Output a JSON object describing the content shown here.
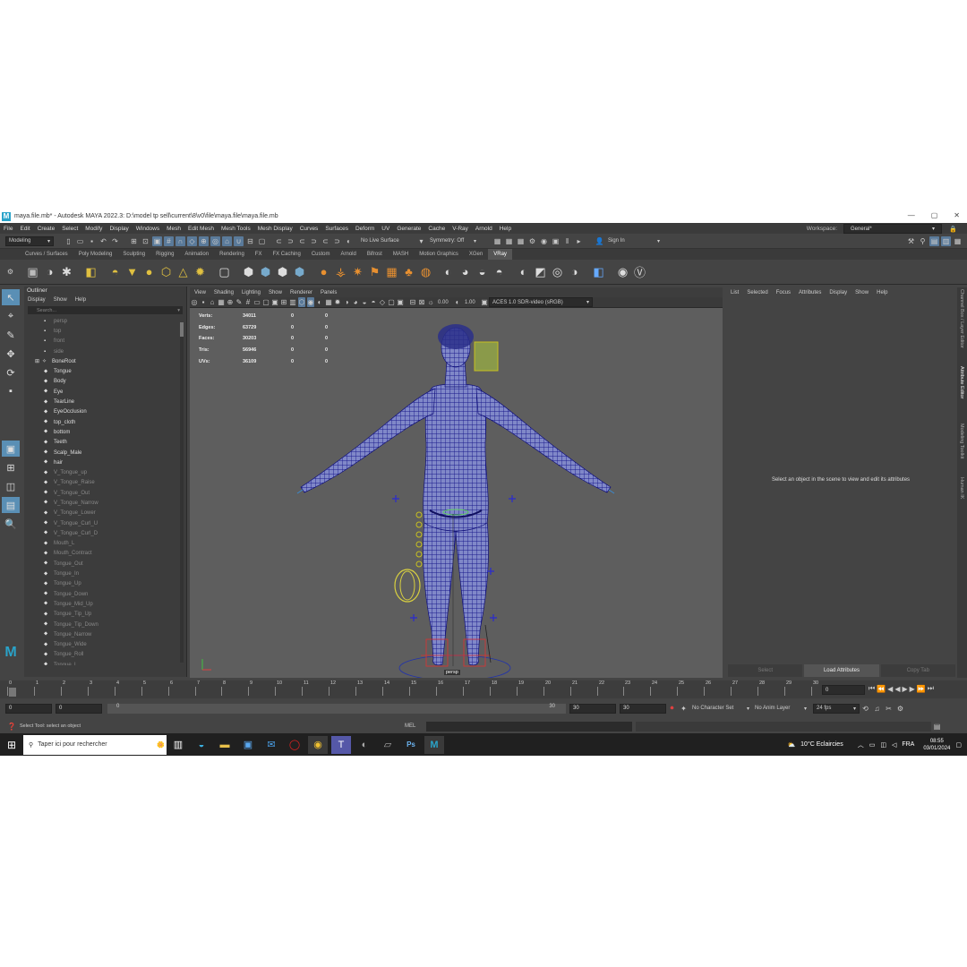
{
  "window": {
    "title": "maya.file.mb* - Autodesk MAYA 2022.3: D:\\model tp sell\\current\\8\\v0\\file\\maya.file\\maya.file.mb",
    "logo": "M",
    "controls": [
      "—",
      "▢",
      "✕"
    ]
  },
  "menu": [
    "File",
    "Edit",
    "Create",
    "Select",
    "Modify",
    "Display",
    "Windows",
    "Mesh",
    "Edit Mesh",
    "Mesh Tools",
    "Mesh Display",
    "Curves",
    "Surfaces",
    "Deform",
    "UV",
    "Generate",
    "Cache",
    "V-Ray",
    "Arnold",
    "Help"
  ],
  "workspace": {
    "label": "Workspace:",
    "value": "General*"
  },
  "status": {
    "mode": "Modeling",
    "live_surface": "No Live Surface",
    "symmetry": "Symmetry: Off",
    "sign_in": "Sign In"
  },
  "shelf_tabs": [
    "Curves / Surfaces",
    "Poly Modeling",
    "Sculpting",
    "Rigging",
    "Animation",
    "Rendering",
    "FX",
    "FX Caching",
    "Custom",
    "Arnold",
    "Bifrost",
    "MASH",
    "Motion Graphics",
    "XGen",
    "VRay"
  ],
  "shelf_active": "VRay",
  "outliner": {
    "title": "Outliner",
    "menu": [
      "Display",
      "Show",
      "Help"
    ],
    "search_placeholder": "Search...",
    "items": [
      {
        "name": "persp",
        "icon": "camera",
        "dim": true
      },
      {
        "name": "top",
        "icon": "camera",
        "dim": true
      },
      {
        "name": "front",
        "icon": "camera",
        "dim": true
      },
      {
        "name": "side",
        "icon": "camera",
        "dim": true
      },
      {
        "name": "BoneRoot",
        "icon": "joint",
        "dim": false,
        "expandable": true
      },
      {
        "name": "Tongue",
        "icon": "mesh",
        "dim": false
      },
      {
        "name": "Body",
        "icon": "mesh",
        "dim": false
      },
      {
        "name": "Eye",
        "icon": "mesh",
        "dim": false
      },
      {
        "name": "TearLine",
        "icon": "mesh",
        "dim": false
      },
      {
        "name": "EyeOcclusion",
        "icon": "mesh",
        "dim": false
      },
      {
        "name": "top_cloth",
        "icon": "mesh",
        "dim": false
      },
      {
        "name": "bottom",
        "icon": "mesh",
        "dim": false
      },
      {
        "name": "Teeth",
        "icon": "mesh",
        "dim": false
      },
      {
        "name": "Scalp_Male",
        "icon": "mesh",
        "dim": false
      },
      {
        "name": "hair",
        "icon": "mesh",
        "dim": false
      },
      {
        "name": "V_Tongue_up",
        "icon": "mesh",
        "dim": true
      },
      {
        "name": "V_Tongue_Raise",
        "icon": "mesh",
        "dim": true
      },
      {
        "name": "V_Tongue_Out",
        "icon": "mesh",
        "dim": true
      },
      {
        "name": "V_Tongue_Narrow",
        "icon": "mesh",
        "dim": true
      },
      {
        "name": "V_Tongue_Lower",
        "icon": "mesh",
        "dim": true
      },
      {
        "name": "V_Tongue_Curl_U",
        "icon": "mesh",
        "dim": true
      },
      {
        "name": "V_Tongue_Curl_D",
        "icon": "mesh",
        "dim": true
      },
      {
        "name": "Mouth_L",
        "icon": "mesh",
        "dim": true
      },
      {
        "name": "Mouth_Contract",
        "icon": "mesh",
        "dim": true
      },
      {
        "name": "Tongue_Out",
        "icon": "mesh",
        "dim": true
      },
      {
        "name": "Tongue_In",
        "icon": "mesh",
        "dim": true
      },
      {
        "name": "Tongue_Up",
        "icon": "mesh",
        "dim": true
      },
      {
        "name": "Tongue_Down",
        "icon": "mesh",
        "dim": true
      },
      {
        "name": "Tongue_Mid_Up",
        "icon": "mesh",
        "dim": true
      },
      {
        "name": "Tongue_Tip_Up",
        "icon": "mesh",
        "dim": true
      },
      {
        "name": "Tongue_Tip_Down",
        "icon": "mesh",
        "dim": true
      },
      {
        "name": "Tongue_Narrow",
        "icon": "mesh",
        "dim": true
      },
      {
        "name": "Tongue_Wide",
        "icon": "mesh",
        "dim": true
      },
      {
        "name": "Tongue_Roll",
        "icon": "mesh",
        "dim": true
      },
      {
        "name": "Tongue_L",
        "icon": "mesh",
        "dim": true
      }
    ]
  },
  "viewport": {
    "menu": [
      "View",
      "Shading",
      "Lighting",
      "Show",
      "Renderer",
      "Panels"
    ],
    "exposure": "0.00",
    "gamma": "1.00",
    "color_space": "ACES 1.0 SDR-video (sRGB)",
    "camera_label": "persp",
    "stats": [
      {
        "label": "Verts:",
        "a": "34011",
        "b": "0",
        "c": "0"
      },
      {
        "label": "Edges:",
        "a": "63729",
        "b": "0",
        "c": "0"
      },
      {
        "label": "Faces:",
        "a": "30203",
        "b": "0",
        "c": "0"
      },
      {
        "label": "Tris:",
        "a": "56946",
        "b": "0",
        "c": "0"
      },
      {
        "label": "UVs:",
        "a": "36109",
        "b": "0",
        "c": "0"
      }
    ]
  },
  "attribute_editor": {
    "menu": [
      "List",
      "Selected",
      "Focus",
      "Attributes",
      "Display",
      "Show",
      "Help"
    ],
    "message": "Select an object in the scene to view and edit its attributes",
    "buttons": [
      "Select",
      "Load Attributes",
      "Copy Tab"
    ],
    "side_tabs": [
      "Channel Box / Layer Editor",
      "Attribute Editor",
      "Modeling Toolkit",
      "Human IK"
    ]
  },
  "timeline": {
    "ticks": [
      "0",
      "1",
      "2",
      "3",
      "4",
      "5",
      "6",
      "7",
      "8",
      "9",
      "10",
      "11",
      "12",
      "13",
      "14",
      "15",
      "16",
      "17",
      "18",
      "19",
      "20",
      "21",
      "22",
      "23",
      "24",
      "25",
      "26",
      "27",
      "28",
      "29",
      "30"
    ],
    "current_frame": "0"
  },
  "range": {
    "start": "0",
    "anim_start": "0",
    "slider_start": "0",
    "slider_end": "30",
    "end": "30",
    "anim_end": "30",
    "character_set": "No Character Set",
    "anim_layer": "No Anim Layer",
    "fps": "24 fps"
  },
  "command": {
    "help": "Select Tool: select an object",
    "lang": "MEL"
  },
  "taskbar": {
    "search": "Taper ici pour rechercher",
    "weather": "10°C  Eclaircies",
    "lang": "FRA",
    "time": "08:55",
    "date": "03/01/2024"
  },
  "colors": {
    "accent": "#5a8fb5",
    "wireframe": "#1a1a8c",
    "viewport_bg": "#5e5e5e",
    "maya_teal": "#2aa3c9"
  }
}
